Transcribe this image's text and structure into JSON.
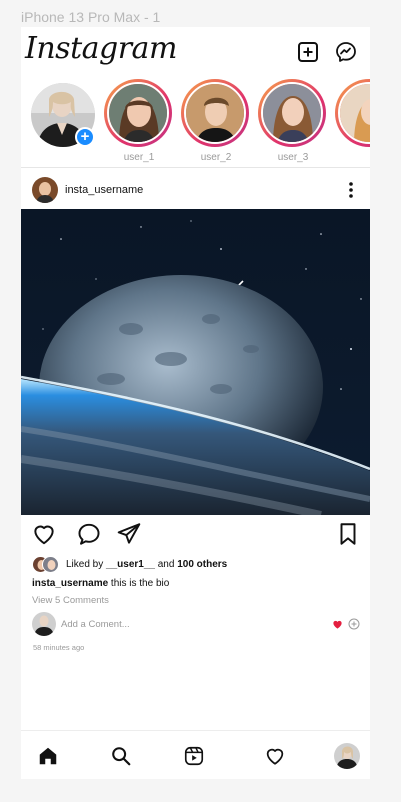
{
  "frame": {
    "label": "iPhone 13 Pro Max - 1"
  },
  "header": {
    "logo_text": "Instagram",
    "icons": [
      "add-post-icon",
      "messenger-icon"
    ]
  },
  "stories": {
    "own_story_icon": "plus-icon",
    "items": [
      {
        "label": "user_1"
      },
      {
        "label": "user_2"
      },
      {
        "label": "user_3"
      }
    ]
  },
  "post": {
    "username": "insta_username",
    "menu_icon": "more-vertical-icon",
    "actions": [
      "heart-icon",
      "comment-icon",
      "share-icon",
      "bookmark-icon"
    ],
    "likes": {
      "prefix": "Liked by ",
      "user": "__user1__",
      "middle": " and ",
      "others": "100 others"
    },
    "caption": {
      "username": "insta_username",
      "text": " this is the bio"
    },
    "view_comments": "View 5 Comments",
    "comment_placeholder": "Add a Coment...",
    "timestamp": "58 minutes ago"
  },
  "bottom_nav": {
    "icons": [
      "home-icon",
      "search-icon",
      "reels-icon",
      "activity-heart-icon",
      "profile-avatar"
    ]
  },
  "colors": {
    "accent_blue": "#1a8cff",
    "heart_red": "#e41e3f",
    "story_ring": "#e0336b"
  }
}
